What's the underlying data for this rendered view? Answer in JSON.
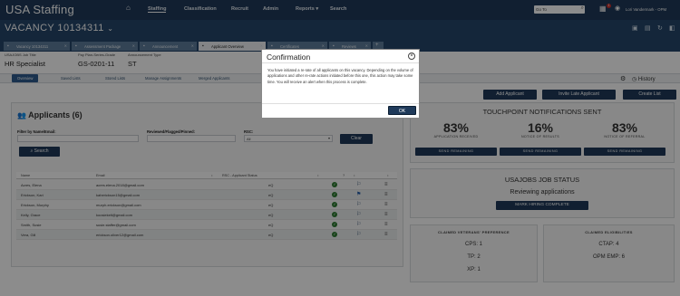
{
  "header": {
    "logo": "USA Staffing",
    "nav": [
      "Staffing",
      "Classification",
      "Recruit",
      "Admin",
      "Reports",
      "Search"
    ],
    "reports_caret": "▾",
    "search_placeholder": "Go To",
    "notif_count": "1",
    "user": "Lori Vandermark - OPM"
  },
  "vacancy": {
    "title": "VACANCY 10134311",
    "caret": "⌄"
  },
  "tabs": [
    {
      "label": "Vacancy 10134311"
    },
    {
      "label": "Assessment Package"
    },
    {
      "label": "Announcement"
    },
    {
      "label": "Applicant Overview"
    },
    {
      "label": "Certificates"
    },
    {
      "label": "Reviews"
    }
  ],
  "tab_add": "+",
  "fields": [
    {
      "label": "USAJOBS Job Title",
      "value": "HR Specialist"
    },
    {
      "label": "Pay Plan-Series-Grade",
      "value": "GS-0201-11"
    },
    {
      "label": "Announcement Type",
      "value": "ST"
    }
  ],
  "subnav": [
    "Overview",
    "Saved Lists",
    "Stored Lists",
    "Manage Assignments",
    "Merged Applicants"
  ],
  "history": "History",
  "actions": [
    "Add Applicant",
    "Invite Late Applicant",
    "Create List"
  ],
  "applicants": {
    "title": "Applicants (6)",
    "filter_label": "Filter by Name/Email:",
    "flag_label": "Reviewed/Flagged/Pinned:",
    "rsc_label": "RSC:",
    "rsc_value": "All",
    "clear": "Clear",
    "search": "Search",
    "columns": [
      "Name",
      "Email",
      "RSC - Applicant Status",
      "",
      "?",
      "",
      ""
    ],
    "rows": [
      {
        "name": "Acres, Elena",
        "email": "acres.elena.2018@gmail.com",
        "status": "eQ"
      },
      {
        "name": "Erickson, Kari",
        "email": "kaherickson15@gmail.com",
        "status": "eQ"
      },
      {
        "name": "Erickson, Murphy",
        "email": "murph.erickson@gmail.com",
        "status": "eQ"
      },
      {
        "name": "Kelly, Grace",
        "email": "koosiekelt@gmail.com",
        "status": "eQ"
      },
      {
        "name": "Smith, Susie",
        "email": "susie.staffer@gmail.com",
        "status": "eQ"
      },
      {
        "name": "Vera, Gill",
        "email": "erickson.oliver12@gmail.com",
        "status": "eQ"
      }
    ]
  },
  "touchpoint": {
    "title": "TOUCHPOINT NOTIFICATIONS SENT",
    "items": [
      {
        "pct": "83%",
        "label": "APPLICATION RECEIVED",
        "btn": "SEND REMAINING"
      },
      {
        "pct": "16%",
        "label": "NOTICE OF RESULTS",
        "btn": "SEND REMAINING"
      },
      {
        "pct": "83%",
        "label": "NOTICE OF REFERRAL",
        "btn": "SEND REMAINING"
      }
    ]
  },
  "usajobs": {
    "title": "USAJOBS JOB STATUS",
    "status": "Reviewing applications",
    "btn": "MARK HIRING COMPLETE"
  },
  "veterans": {
    "title": "CLAIMED VETERANS' PREFERENCE",
    "items": [
      "CPS: 1",
      "TP: 2",
      "XP: 1"
    ]
  },
  "eligibilities": {
    "title": "CLAIMED ELIGIBILITIES",
    "items": [
      "CTAP: 4",
      "OPM EMP: 6"
    ]
  },
  "modal": {
    "title": "Confirmation",
    "close": "×",
    "body": "You have initiated a re-rate of all applicants on this vacancy. Depending on the volume of applications and other re-rate actions initiated before this one, this action may take some time. You will receive an alert when this process is complete.",
    "ok": "OK"
  }
}
